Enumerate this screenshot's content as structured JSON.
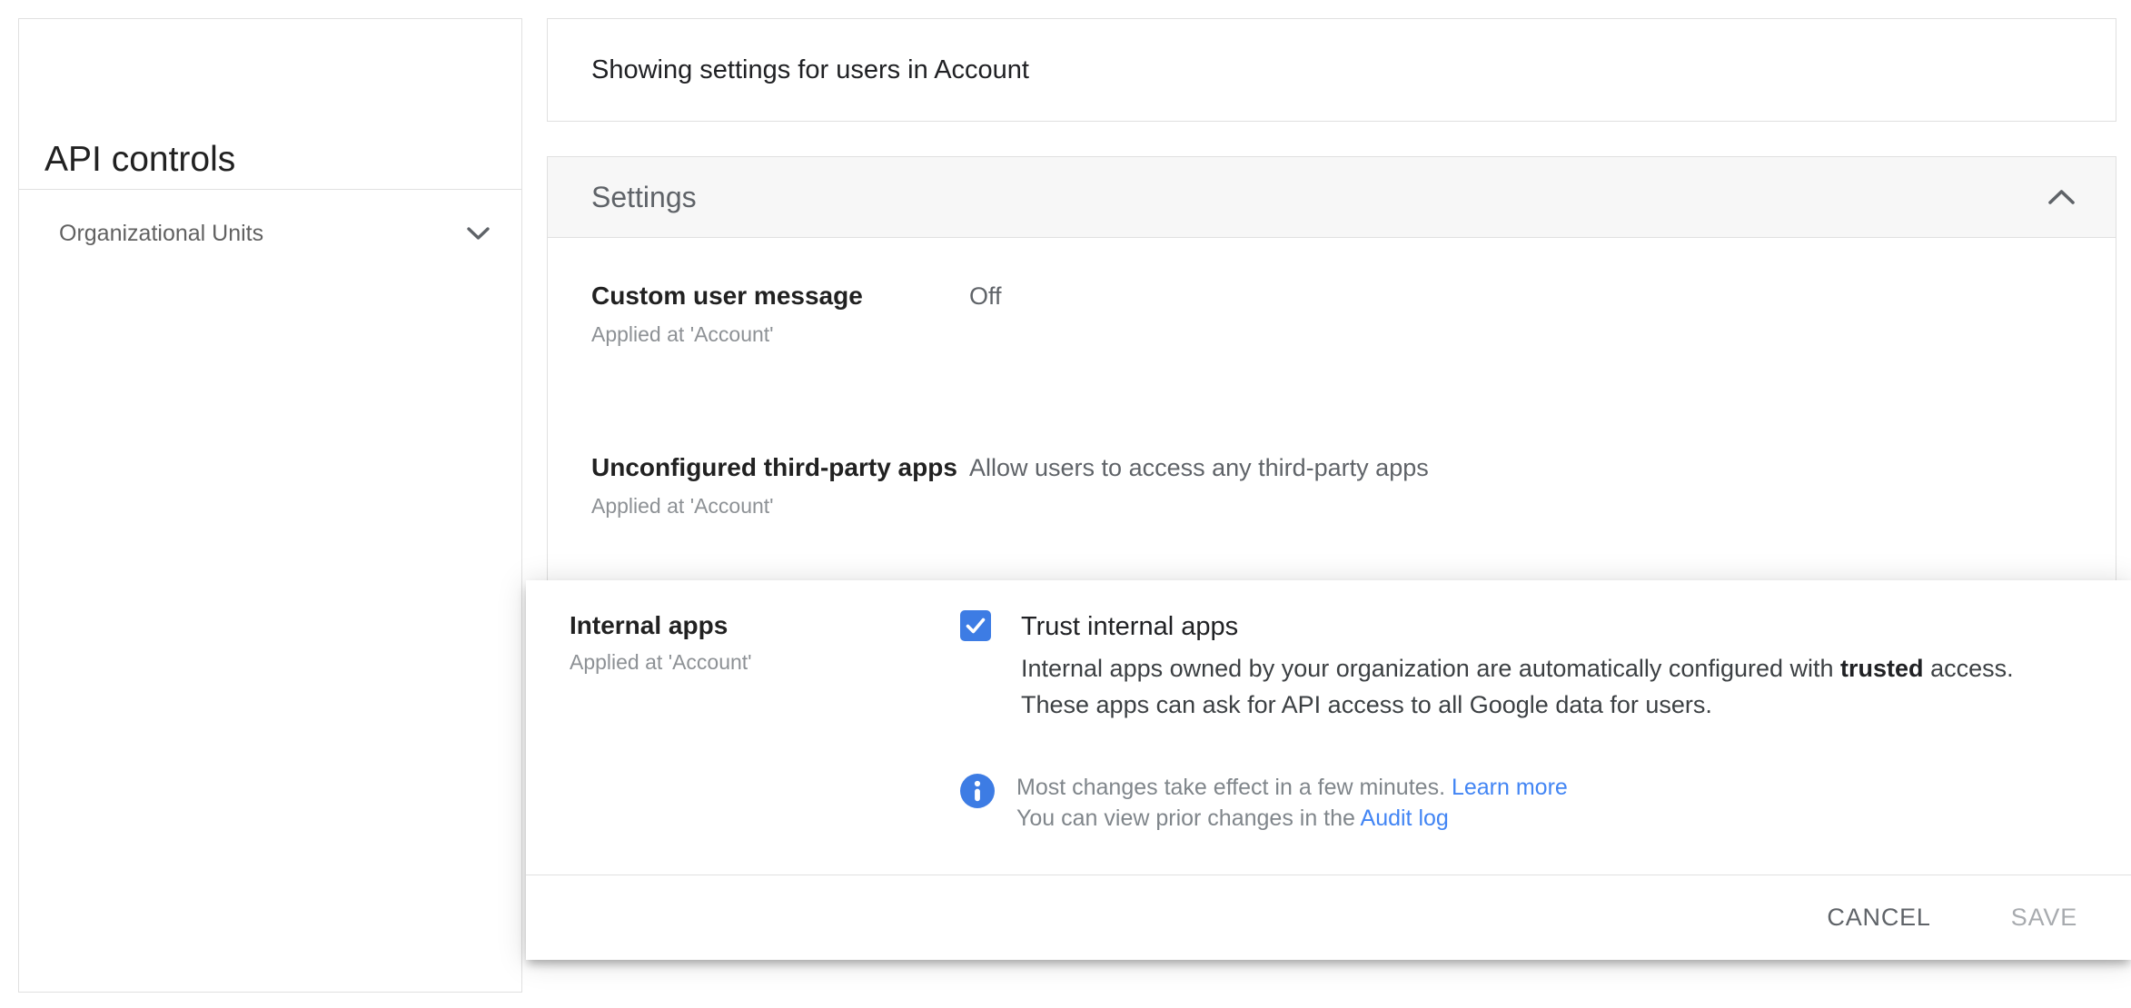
{
  "sidebar": {
    "title": "API controls",
    "item": {
      "label": "Organizational Units"
    }
  },
  "main": {
    "scope_banner": "Showing settings for users in Account",
    "settings": {
      "title": "Settings",
      "rows": [
        {
          "label": "Custom user message",
          "applied_at": "Applied at 'Account'",
          "value": "Off"
        },
        {
          "label": "Unconfigured third-party apps",
          "applied_at": "Applied at 'Account'",
          "value": "Allow users to access any third-party apps"
        }
      ]
    }
  },
  "edit_card": {
    "label": "Internal apps",
    "applied_at": "Applied at 'Account'",
    "checkbox": {
      "checked": true,
      "label": "Trust internal apps"
    },
    "description": {
      "line1_prefix": "Internal apps owned by your organization are automatically configured with",
      "line1_bold": "trusted",
      "line1_suffix": "access.",
      "line2": "These apps can ask for API access to all Google data for users."
    },
    "notice": {
      "line1_text": "Most changes take effect in a few minutes.",
      "line1_link": "Learn more",
      "line2_text": "You can view prior changes in the",
      "line2_link": "Audit log"
    },
    "actions": {
      "cancel": "CANCEL",
      "save": "SAVE"
    }
  },
  "icons": {
    "sidebar_item": "chevron-down",
    "settings_header": "chevron-up",
    "checkbox": "checkmark",
    "notice": "info-circle"
  },
  "colors": {
    "checkbox_blue": "#3d7ce4",
    "link_blue": "#4285f4",
    "border": "#e0e0e0",
    "settings_header_bg": "#f7f7f7"
  }
}
